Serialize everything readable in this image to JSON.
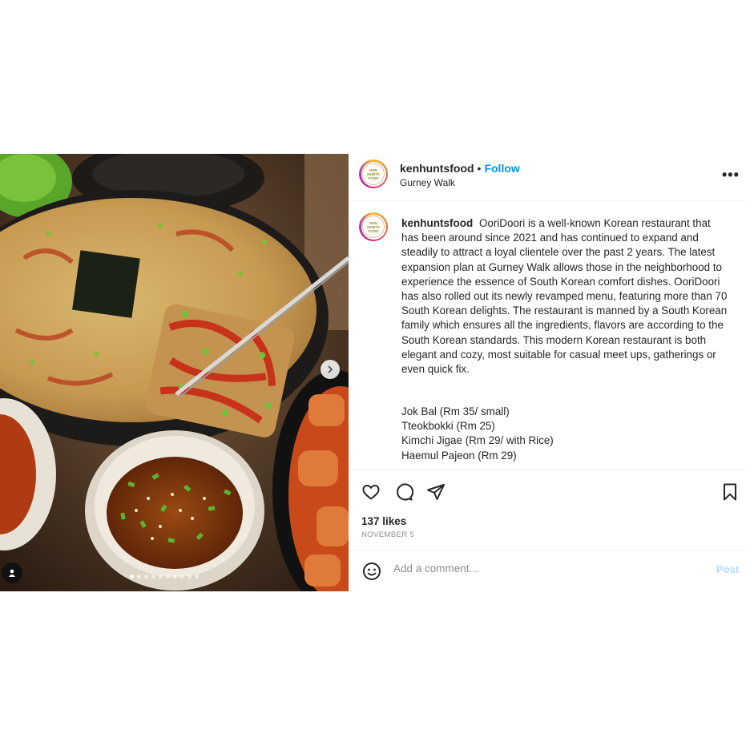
{
  "post": {
    "username": "kenhuntsfood",
    "separator": "•",
    "follow_label": "Follow",
    "location": "Gurney Walk",
    "more_label": "•••",
    "avatar_logo_lines": [
      "KEN",
      "HUNTS",
      "FOOD"
    ],
    "caption_text": "OoriDoori is a well-known Korean restaurant that has been around since 2021 and has continued to expand and steadily to attract a loyal clientele over the past 2 years. The latest expansion plan at Gurney Walk allows those in the neighborhood to experience the essence of South Korean comfort dishes. OoriDoori has also rolled out its newly revamped menu, featuring more than 70 South Korean delights. The restaurant is manned by a South Korean family which ensures all the ingredients, flavors are according to the South Korean standards. This modern Korean restaurant is both elegant and cozy, most suitable for casual meet ups, gatherings or even quick fix.",
    "menu_items": [
      "Jok Bal (Rm 35/ small)",
      "Tteokbokki (Rm 25)",
      "Kimchi Jigae (Rm 29/ with Rice)",
      "Haemul Pajeon (Rm 29)"
    ],
    "likes": "137 likes",
    "date": "NOVEMBER 5",
    "comment_placeholder": "Add a comment...",
    "post_label": "Post"
  },
  "carousel": {
    "total_slides": 10,
    "active_index": 0
  },
  "icons": {
    "like": "heart-icon",
    "comment": "comment-icon",
    "share": "share-icon",
    "save": "bookmark-icon",
    "emoji": "emoji-icon",
    "next": "chevron-right-icon",
    "tag": "user-tag-icon",
    "more": "more-options-icon"
  },
  "colors": {
    "follow": "#0095f6",
    "post_disabled": "#b3dbff",
    "muted": "#8e8e8e"
  }
}
